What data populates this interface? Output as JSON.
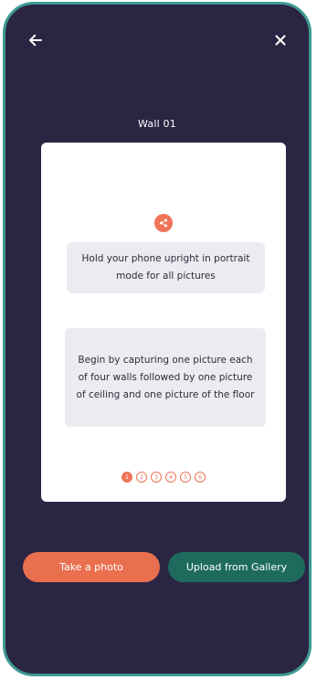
{
  "header": {
    "back_icon": "arrow-left-icon",
    "close_icon": "close-icon",
    "title": "Wall 01"
  },
  "card": {
    "badge_icon": "share-icon",
    "tip_primary": "Hold your phone upright in portrait mode for all pictures",
    "tip_secondary": "Begin by capturing one picture each of four walls followed by one picture of ceiling and one picture of the floor",
    "steps": [
      "1",
      "2",
      "3",
      "4",
      "5",
      "6"
    ],
    "active_step": 1
  },
  "actions": {
    "take_photo": "Take a photo",
    "upload_gallery": "Upload from Gallery"
  },
  "colors": {
    "background": "#2b2544",
    "frame": "#3e9a92",
    "accent": "#f07457",
    "gallery": "#1e6b5e"
  }
}
